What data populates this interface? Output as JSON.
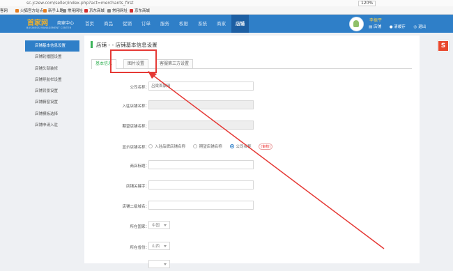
{
  "browser": {
    "url": "sc.jczew.com/seller/index.php?act=merchants_first",
    "zoom": "120%",
    "bookmarks": [
      "客网",
      "火狐官方站点",
      "新手上路",
      "常用网址",
      "京东商城",
      "常用网址",
      "京东商城"
    ]
  },
  "header": {
    "logo": "首家网",
    "logo_sub": "BUSINESS MANAGEMENT CENTER",
    "center_label": "商家中心",
    "nav": [
      "首页",
      "商品",
      "促销",
      "订单",
      "服务",
      "权限",
      "系统",
      "商家",
      "店铺"
    ],
    "active_nav": "店铺",
    "username": "李振平",
    "links": [
      "店铺",
      "清缓存",
      "退出"
    ]
  },
  "sidebar": {
    "items": [
      "店铺基本信息设置",
      "店铺轮播图设置",
      "店铺头部装修",
      "店铺导航栏设置",
      "店铺背景设置",
      "店铺橱窗设置",
      "店铺模板选择",
      "店铺申请入驻"
    ],
    "active_index": 0
  },
  "main": {
    "title": "店铺 - - 店铺基本信息设置",
    "tabs": [
      "基本信息",
      "图片设置",
      "客服第三方设置"
    ],
    "active_tab": 0,
    "form": {
      "company_label": "公司名称：",
      "company_value": "吕梁首家网",
      "settled_name_label": "入驻店铺名称：",
      "expected_name_label": "期望店铺名称：",
      "display_name_label": "显示店铺名称：",
      "display_options": [
        "入驻品牌店铺名称",
        "期望店铺名称",
        "公司名称"
      ],
      "display_selected": 2,
      "display_hint": "(审核)",
      "store_title_label": "商店标题：",
      "keywords_label": "店铺关键字：",
      "domain_label": "店铺二级域名：",
      "country_label": "所在国家：",
      "country_value": "中国",
      "province_label": "所在省份：",
      "province_value": "山西"
    }
  },
  "widget_label": "S",
  "colors": {
    "header_bg": "#2f7fc8",
    "active_nav_bg": "#1d5fa3",
    "logo": "#f2b12a",
    "accent_green": "#3cb35b",
    "annotation_red": "#e53935"
  }
}
